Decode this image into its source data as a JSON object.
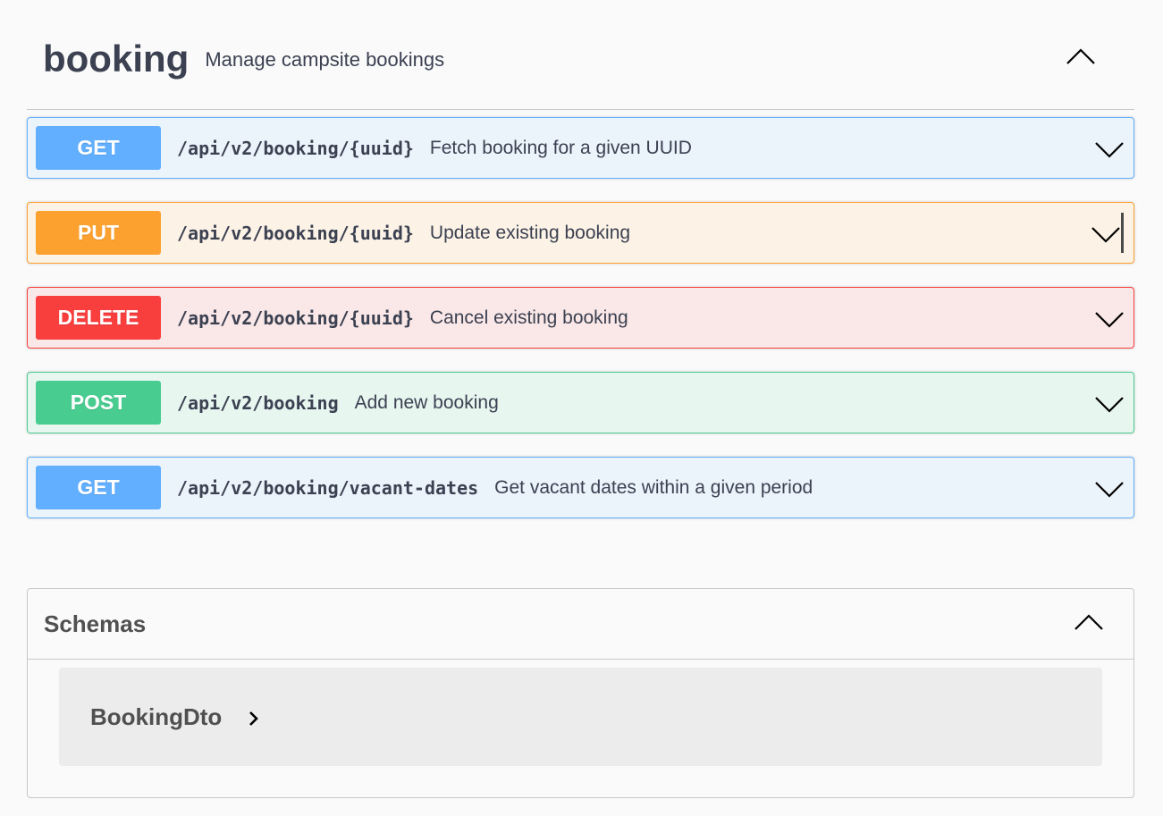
{
  "tag": {
    "name": "booking",
    "description": "Manage campsite bookings"
  },
  "operations": [
    {
      "method": "GET",
      "path": "/api/v2/booking/{uuid}",
      "summary": "Fetch booking for a given UUID"
    },
    {
      "method": "PUT",
      "path": "/api/v2/booking/{uuid}",
      "summary": "Update existing booking"
    },
    {
      "method": "DELETE",
      "path": "/api/v2/booking/{uuid}",
      "summary": "Cancel existing booking"
    },
    {
      "method": "POST",
      "path": "/api/v2/booking",
      "summary": "Add new booking"
    },
    {
      "method": "GET",
      "path": "/api/v2/booking/vacant-dates",
      "summary": "Get vacant dates within a given period"
    }
  ],
  "schemas": {
    "title": "Schemas",
    "models": [
      {
        "name": "BookingDto"
      }
    ]
  },
  "colors": {
    "get": "#61affe",
    "put": "#fca130",
    "delete": "#f93e3e",
    "post": "#49cc90",
    "text": "#3b4151"
  },
  "icons": {
    "tag_toggle": "chevron-up-icon",
    "op_toggle": "chevron-down-icon",
    "schemas_toggle": "chevron-up-icon",
    "model_expand": "chevron-right-icon"
  }
}
